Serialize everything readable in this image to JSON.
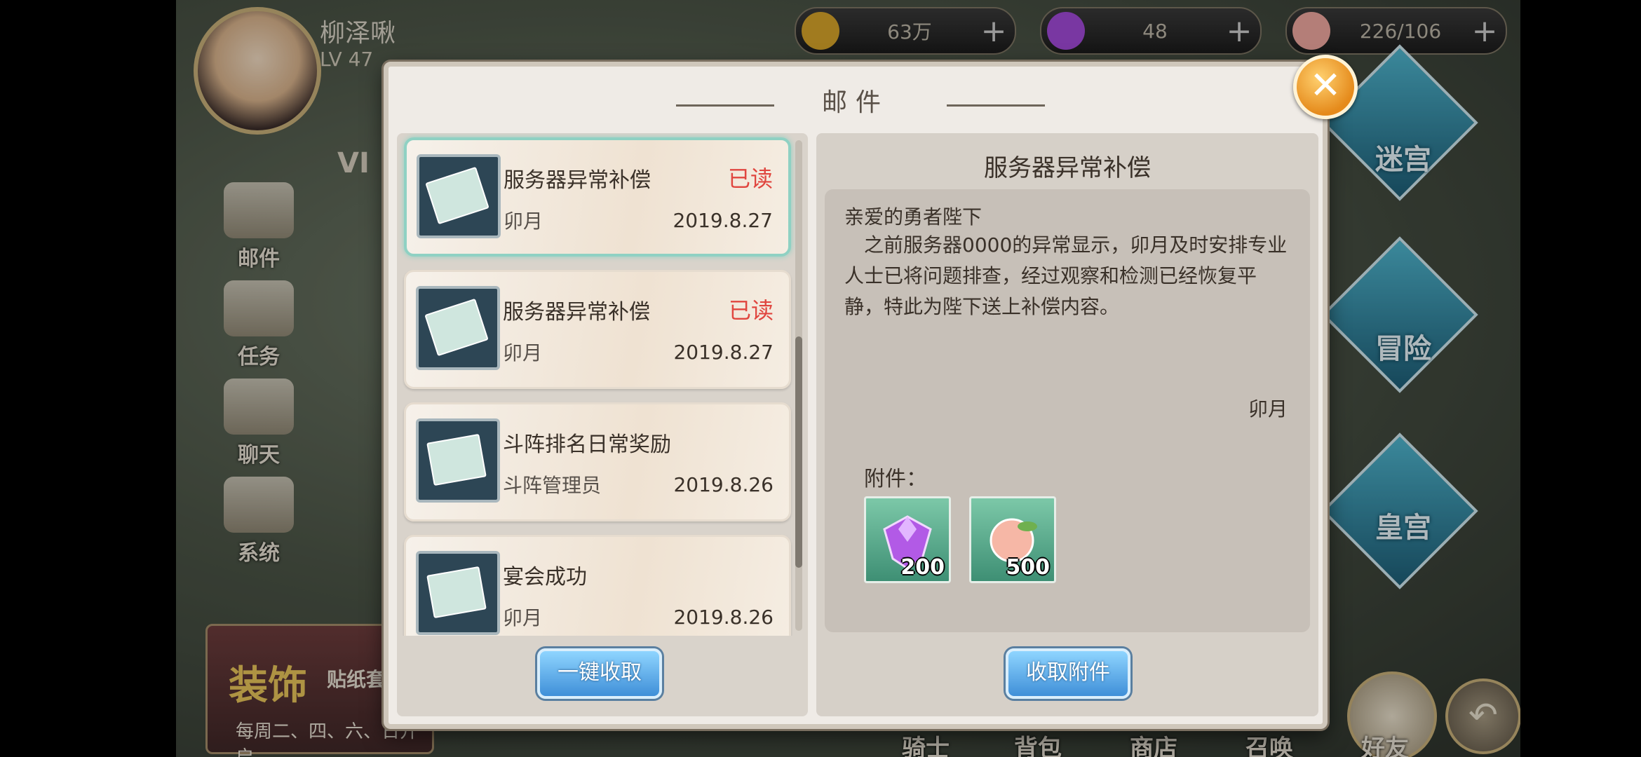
{
  "player": {
    "name": "柳泽啾",
    "level_label": "LV 47"
  },
  "resources": [
    {
      "icon": "gold-coin-icon",
      "value": "63万",
      "color": "#d7a52a"
    },
    {
      "icon": "purple-gem-icon",
      "value": "48",
      "color": "#a24ad8"
    },
    {
      "icon": "peach-icon",
      "value": "226/106",
      "color": "#f1a9a0"
    }
  ],
  "side_menu": [
    {
      "label": "邮件"
    },
    {
      "label": "任务"
    },
    {
      "label": "聊天"
    },
    {
      "label": "系统"
    }
  ],
  "vip_label": "VI",
  "decor_banner": {
    "title": "装饰",
    "subtitle": "贴纸套",
    "note": "每周二、四、六、日开启"
  },
  "map_nodes": [
    "迷宫",
    "冒险",
    "皇宫"
  ],
  "bottom_nav": [
    "骑士",
    "背包",
    "商店",
    "召唤",
    "好友"
  ],
  "dialog": {
    "title": "邮件",
    "close_label": "✕",
    "mails": [
      {
        "title": "服务器异常补偿",
        "status": "已读",
        "from": "卯月",
        "date": "2019.8.27",
        "selected": true
      },
      {
        "title": "服务器异常补偿",
        "status": "已读",
        "from": "卯月",
        "date": "2019.8.27",
        "selected": false
      },
      {
        "title": "斗阵排名日常奖励",
        "status": "",
        "from": "斗阵管理员",
        "date": "2019.8.26",
        "selected": false
      },
      {
        "title": "宴会成功",
        "status": "",
        "from": "卯月",
        "date": "2019.8.26",
        "selected": false
      }
    ],
    "collect_all_label": "一键收取",
    "detail": {
      "title": "服务器异常补偿",
      "greeting": "亲爱的勇者陛下",
      "body": "之前服务器0000的异常显示，卯月及时安排专业人士已将问题排查，经过观察和检测已经恢复平静，特此为陛下送上补偿内容。",
      "signature": "卯月",
      "attachments_label": "附件：",
      "attachments": [
        {
          "icon": "purple-gem-icon",
          "qty": "200"
        },
        {
          "icon": "peach-icon",
          "qty": "500"
        }
      ],
      "collect_label": "收取附件"
    }
  }
}
